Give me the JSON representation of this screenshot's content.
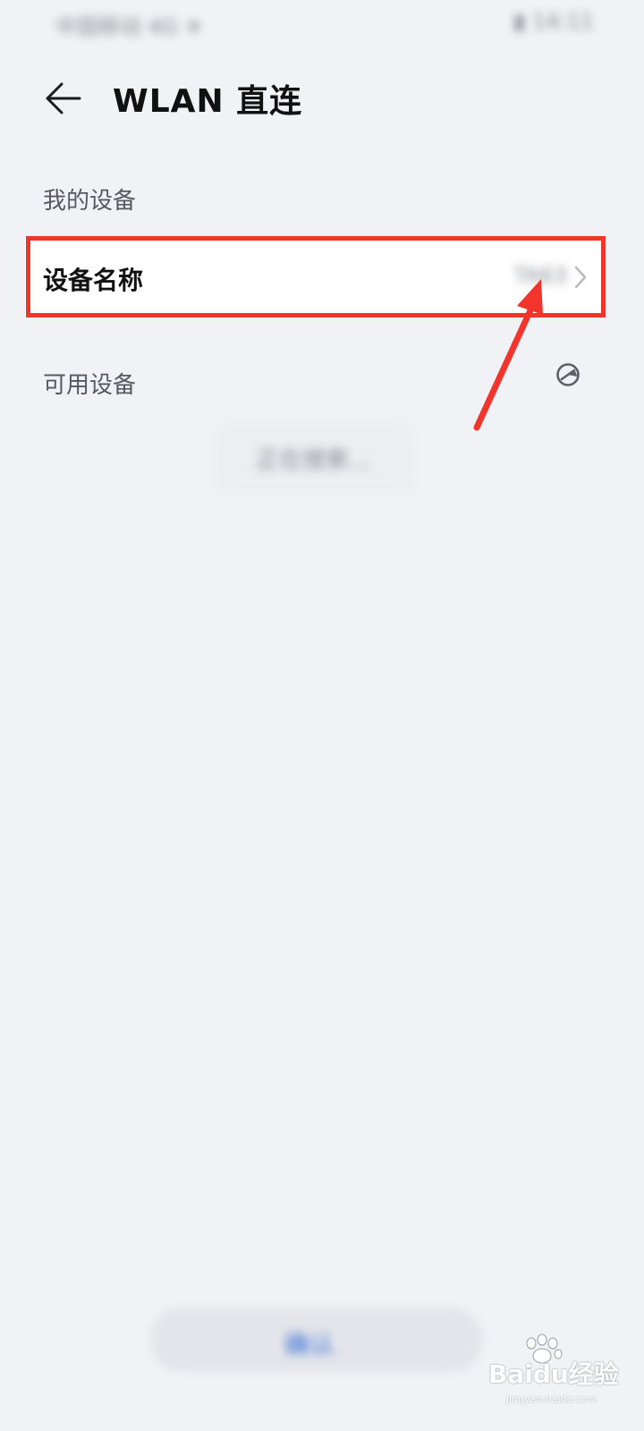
{
  "status_bar": {
    "left_text": "中国移动 4G ✈",
    "right_text": "▮ 14:11"
  },
  "header": {
    "back_icon": "arrow-left-icon",
    "title": "WLAN 直连"
  },
  "my_device": {
    "section_label": "我的设备",
    "item_label": "设备名称",
    "item_value": "TA63",
    "chevron_icon": "chevron-right-icon"
  },
  "available_devices": {
    "section_label": "可用设备",
    "scan_icon": "refresh-scan-icon",
    "status_text": "正在搜索..."
  },
  "bottom_button": {
    "label": "确认"
  },
  "watermark": {
    "text": "Baidu经验",
    "sub": "jingyan.baidu.com"
  },
  "colors": {
    "background": "#f1f2f6",
    "highlight": "#f1352c",
    "accent": "#3a6fd8"
  }
}
